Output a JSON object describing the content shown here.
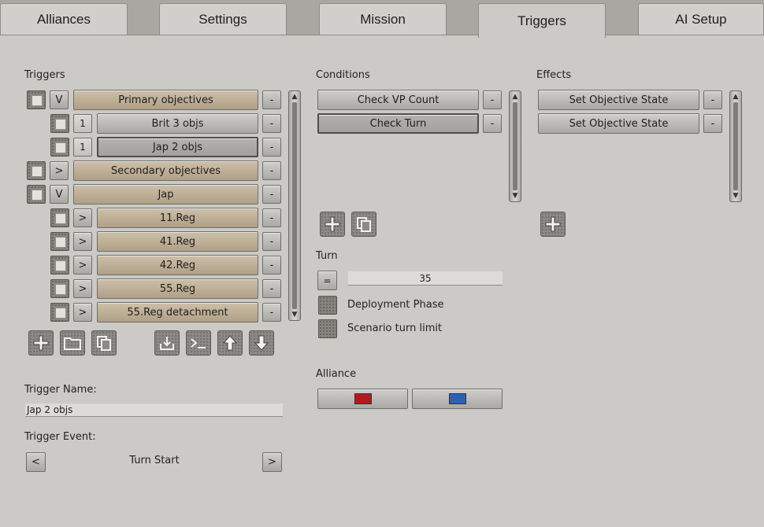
{
  "tabs": [
    {
      "label": "Alliances"
    },
    {
      "label": "Settings"
    },
    {
      "label": "Mission"
    },
    {
      "label": "Triggers"
    },
    {
      "label": "AI Setup"
    }
  ],
  "triggers": {
    "heading": "Triggers",
    "remove_label": "-",
    "rows": [
      {
        "toggle": "V",
        "label": "Primary objectives"
      },
      {
        "toggle": "1",
        "label": "Brit 3 objs"
      },
      {
        "toggle": "1",
        "label": "Jap 2 objs"
      },
      {
        "toggle": ">",
        "label": "Secondary objectives"
      },
      {
        "toggle": "V",
        "label": "Jap"
      },
      {
        "toggle": ">",
        "label": "11.Reg"
      },
      {
        "toggle": ">",
        "label": "41.Reg"
      },
      {
        "toggle": ">",
        "label": "42.Reg"
      },
      {
        "toggle": ">",
        "label": "55.Reg"
      },
      {
        "toggle": ">",
        "label": "55.Reg detachment"
      }
    ],
    "name_label": "Trigger Name:",
    "name_value": "Jap 2 objs",
    "event_label": "Trigger Event:",
    "event_value": "Turn Start",
    "prev_label": "<",
    "next_label": ">"
  },
  "conditions": {
    "heading": "Conditions",
    "remove_label": "-",
    "items": [
      {
        "label": "Check VP Count"
      },
      {
        "label": "Check Turn"
      }
    ],
    "turn_heading": "Turn",
    "operator": "=",
    "turn_value": "35",
    "deployment_label": "Deployment Phase",
    "limit_label": "Scenario turn limit",
    "alliance_heading": "Alliance",
    "alliance_colors": [
      "#b01c1c",
      "#2a62b8"
    ]
  },
  "effects": {
    "heading": "Effects",
    "remove_label": "-",
    "items": [
      {
        "label": "Set Objective State"
      },
      {
        "label": "Set Objective State"
      }
    ]
  }
}
